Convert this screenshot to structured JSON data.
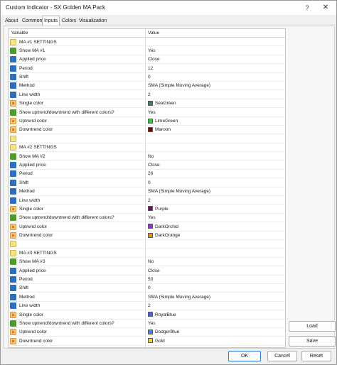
{
  "window": {
    "title": "Custom Indicator - SX Golden MA Pack",
    "help_glyph": "?",
    "close_glyph": "✕"
  },
  "tabs": [
    {
      "label": "About"
    },
    {
      "label": "Common"
    },
    {
      "label": "Inputs"
    },
    {
      "label": "Colors"
    },
    {
      "label": "Visualization"
    }
  ],
  "active_tab": "Inputs",
  "grid": {
    "headers": {
      "variable": "Variable",
      "value": "Value"
    },
    "rows": [
      {
        "type": "section",
        "variable": "MA #1 SETTINGS",
        "value": ""
      },
      {
        "type": "bool",
        "variable": "Show MA #1",
        "value": "Yes"
      },
      {
        "type": "val",
        "variable": "Applied price",
        "value": "Close"
      },
      {
        "type": "val",
        "variable": "Period",
        "value": "12"
      },
      {
        "type": "val",
        "variable": "Shift",
        "value": "0"
      },
      {
        "type": "val",
        "variable": "Method",
        "value": "SMA (Simple Moving Average)"
      },
      {
        "type": "val",
        "variable": "Line width",
        "value": "2"
      },
      {
        "type": "color",
        "variable": "Single color",
        "value": "SeaGreen",
        "swatch": "#2e8b57"
      },
      {
        "type": "bool",
        "variable": "Show uptrend/downtrend with different colors?",
        "value": "Yes"
      },
      {
        "type": "color",
        "variable": "Uptrend color",
        "value": "LimeGreen",
        "swatch": "#32cd32"
      },
      {
        "type": "color",
        "variable": "Downtrend color",
        "value": "Maroon",
        "swatch": "#800000"
      },
      {
        "type": "blank",
        "variable": "",
        "value": ""
      },
      {
        "type": "section",
        "variable": "MA #2 SETTINGS",
        "value": ""
      },
      {
        "type": "bool",
        "variable": "Show MA #2",
        "value": "No"
      },
      {
        "type": "val",
        "variable": "Applied price",
        "value": "Close"
      },
      {
        "type": "val",
        "variable": "Period",
        "value": "26"
      },
      {
        "type": "val",
        "variable": "Shift",
        "value": "0"
      },
      {
        "type": "val",
        "variable": "Method",
        "value": "SMA (Simple Moving Average)"
      },
      {
        "type": "val",
        "variable": "Line width",
        "value": "2"
      },
      {
        "type": "color",
        "variable": "Single color",
        "value": "Purple",
        "swatch": "#800080"
      },
      {
        "type": "bool",
        "variable": "Show uptrend/downtrend with different colors?",
        "value": "Yes"
      },
      {
        "type": "color",
        "variable": "Uptrend color",
        "value": "DarkOrchid",
        "swatch": "#9932cc"
      },
      {
        "type": "color",
        "variable": "Downtrend color",
        "value": "DarkOrange",
        "swatch": "#ff8c00"
      },
      {
        "type": "blank",
        "variable": "",
        "value": ""
      },
      {
        "type": "section",
        "variable": "MA #3 SETTINGS",
        "value": ""
      },
      {
        "type": "bool",
        "variable": "Show MA #3",
        "value": "No"
      },
      {
        "type": "val",
        "variable": "Applied price",
        "value": "Close"
      },
      {
        "type": "val",
        "variable": "Period",
        "value": "50"
      },
      {
        "type": "val",
        "variable": "Shift",
        "value": "0"
      },
      {
        "type": "val",
        "variable": "Method",
        "value": "SMA (Simple Moving Average)"
      },
      {
        "type": "val",
        "variable": "Line width",
        "value": "2"
      },
      {
        "type": "color",
        "variable": "Single color",
        "value": "RoyalBlue",
        "swatch": "#4169e1"
      },
      {
        "type": "bool",
        "variable": "Show uptrend/downtrend with different colors?",
        "value": "Yes"
      },
      {
        "type": "color",
        "variable": "Uptrend color",
        "value": "DodgerBlue",
        "swatch": "#1e90ff"
      },
      {
        "type": "color",
        "variable": "Downtrend color",
        "value": "Gold",
        "swatch": "#ffd700"
      }
    ]
  },
  "buttons": {
    "load": "Load",
    "save": "Save",
    "ok": "OK",
    "cancel": "Cancel",
    "reset": "Reset"
  },
  "icons": {
    "value_icon_text": "123",
    "bool_icon_text": "ab"
  }
}
